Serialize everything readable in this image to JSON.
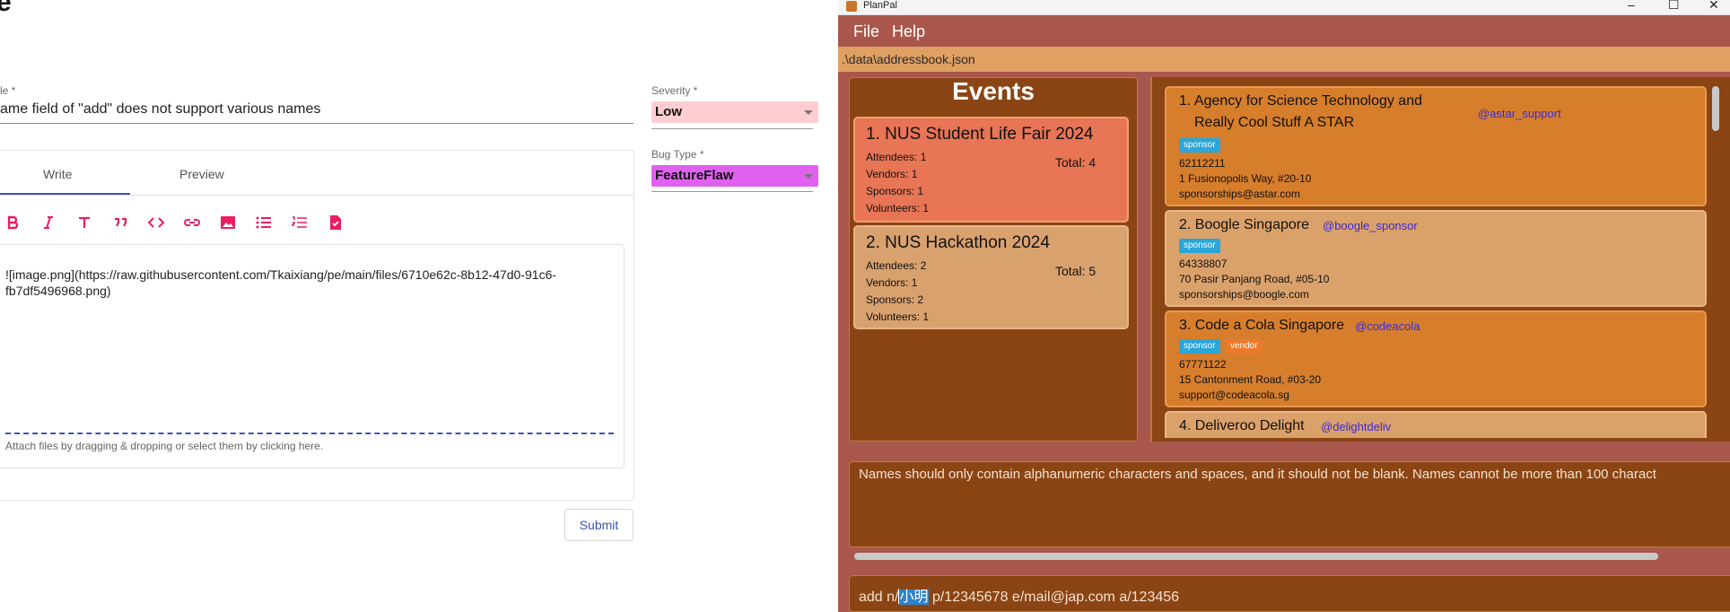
{
  "form": {
    "page_title": "e",
    "title_label": "le *",
    "title_value": "ame field of \"add\" does not support various names",
    "tabs": [
      {
        "label": "Write"
      },
      {
        "label": "Preview"
      }
    ],
    "toolbar_icons": [
      "bold-icon",
      "italic-icon",
      "heading-icon",
      "quote-icon",
      "code-icon",
      "link-icon",
      "image-icon",
      "bulleted-list-icon",
      "numbered-list-icon",
      "task-list-icon"
    ],
    "body_text": "![image.png](https://raw.githubusercontent.com/Tkaixiang/pe/main/files/6710e62c-8b12-47d0-91c6-fb7df5496968.png)",
    "attach_hint": "Attach files by dragging & dropping or select them by clicking here.",
    "submit_label": "Submit",
    "severity": {
      "label": "Severity *",
      "value": "Low",
      "color": "#ffcdd2"
    },
    "bug_type": {
      "label": "Bug Type *",
      "value": "FeatureFlaw",
      "color": "#e060f0"
    }
  },
  "app": {
    "window_title": "PlanPal",
    "window_controls": {
      "minimize": "–",
      "maximize": "☐",
      "close": "✕"
    },
    "menu": {
      "file": "File",
      "help": "Help"
    },
    "path": ".\\data\\addressbook.json",
    "events_title": "Events",
    "events": [
      {
        "title": "1. NUS Student Life Fair 2024",
        "attendees": "Attendees: 1",
        "vendors": "Vendors: 1",
        "sponsors": "Sponsors: 1",
        "volunteers": "Volunteers: 1",
        "total": "Total: 4"
      },
      {
        "title": "2. NUS Hackathon 2024",
        "attendees": "Attendees: 2",
        "vendors": "Vendors: 1",
        "sponsors": "Sponsors: 2",
        "volunteers": "Volunteers: 1",
        "total": "Total: 5"
      }
    ],
    "contacts": [
      {
        "name_line1": "1. Agency for Science Technology and",
        "name_line2": "Really Cool Stuff A STAR",
        "handle": "@astar_support",
        "tags": [
          "sponsor"
        ],
        "phone": "62112211",
        "address": "1 Fusionopolis Way, #20-10",
        "email": "sponsorships@astar.com"
      },
      {
        "name": "2. Boogle Singapore",
        "handle": "@boogle_sponsor",
        "tags": [
          "sponsor"
        ],
        "phone": "64338807",
        "address": "70 Pasir Panjang Road, #05-10",
        "email": "sponsorships@boogle.com"
      },
      {
        "name": "3. Code a Cola Singapore",
        "handle": "@codeacola",
        "tags": [
          "sponsor",
          "vendor"
        ],
        "phone": "67771122",
        "address": "15 Cantonment Road, #03-20",
        "email": "support@codeacola.sg"
      },
      {
        "name": "4. Deliveroo Delight",
        "handle": "@delightdeliv"
      }
    ],
    "result_message": "Names should only contain alphanumeric characters and spaces, and it should not be blank. Names cannot be more than 100 charact",
    "command": {
      "before": "add n/",
      "highlight": "小明",
      "after": " p/12345678 e/mail@jap.com a/123456"
    }
  }
}
